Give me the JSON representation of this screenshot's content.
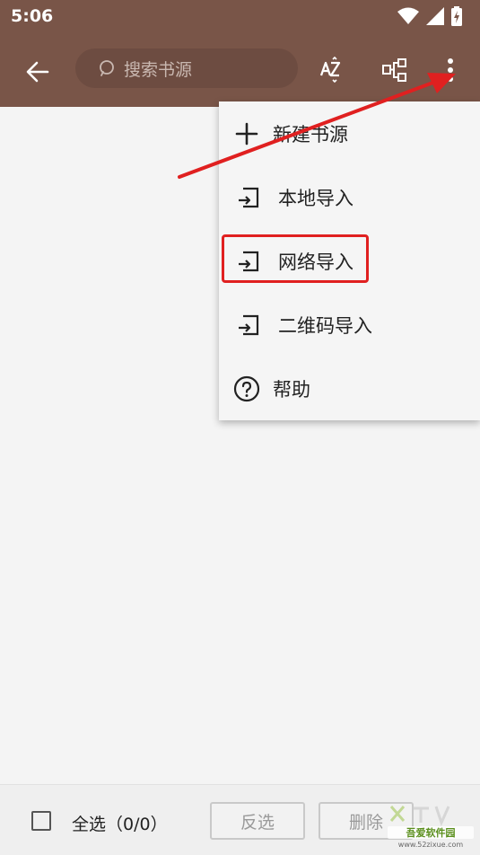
{
  "status_bar": {
    "time": "5:06"
  },
  "toolbar": {
    "search_placeholder": "搜索书源"
  },
  "menu": {
    "items": [
      {
        "label": "新建书源",
        "icon": "plus-icon"
      },
      {
        "label": "本地导入",
        "icon": "import-icon"
      },
      {
        "label": "网络导入",
        "icon": "import-icon"
      },
      {
        "label": "二维码导入",
        "icon": "import-icon"
      },
      {
        "label": "帮助",
        "icon": "help-circle-icon"
      }
    ]
  },
  "bottom_bar": {
    "select_all": "全选（0/0）",
    "invert": "反选",
    "delete": "删除"
  },
  "watermark": {
    "text": "吾爱软件园",
    "url": "www.52zixue.com"
  },
  "colors": {
    "toolbar": "#795548",
    "highlight": "#e02020",
    "arrow": "#e02020"
  }
}
